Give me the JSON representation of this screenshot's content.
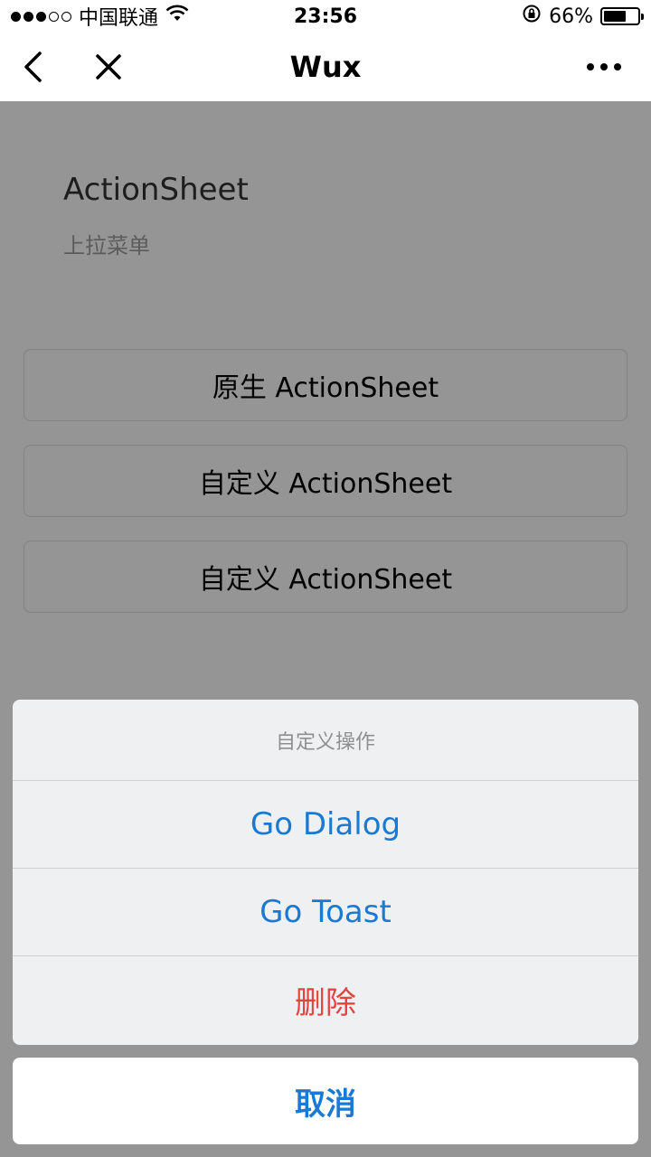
{
  "status_bar": {
    "carrier": "中国联通",
    "time": "23:56",
    "battery": "66%",
    "battery_level": 0.66
  },
  "nav": {
    "title": "Wux",
    "back_icon": "chevron-left-icon",
    "close_icon": "close-icon",
    "more_icon": "more-icon"
  },
  "page": {
    "title": "ActionSheet",
    "subtitle": "上拉菜单",
    "buttons": [
      {
        "label": "原生 ActionSheet"
      },
      {
        "label": "自定义 ActionSheet"
      },
      {
        "label": "自定义 ActionSheet"
      }
    ]
  },
  "action_sheet": {
    "title": "自定义操作",
    "items": [
      {
        "label": "Go Dialog"
      },
      {
        "label": "Go Toast"
      },
      {
        "label": "删除"
      }
    ],
    "cancel_label": "取消",
    "accent_color": "#1a7ad3",
    "destructive_color": "#e64340"
  }
}
